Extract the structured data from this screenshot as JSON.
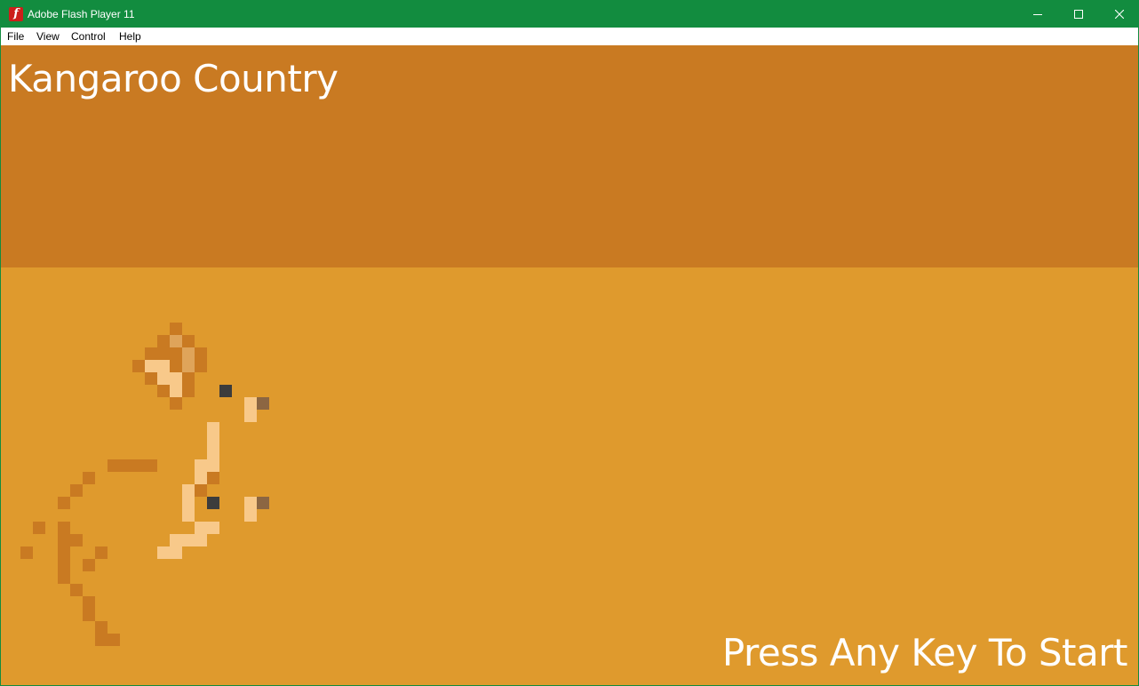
{
  "window": {
    "title": "Adobe Flash Player 11",
    "app_icon": "flash-player-icon",
    "controls": [
      "minimize-icon",
      "maximize-icon",
      "close-icon"
    ],
    "colors": {
      "titlebar": "#128c3f"
    }
  },
  "menu": {
    "file": "File",
    "view": "View",
    "control": "Control",
    "help": "Help"
  },
  "game": {
    "title": "Kangaroo Country",
    "prompt": "Press Any Key To Start",
    "colors": {
      "sky": "#c97a22",
      "ground": "#df9a2d",
      "dark_orange": "#c97a22",
      "light": "#f8c98a",
      "mid": "#dfa45a",
      "brown": "#8c6642",
      "black": "#3c3c3c",
      "text": "#ffffff"
    }
  }
}
